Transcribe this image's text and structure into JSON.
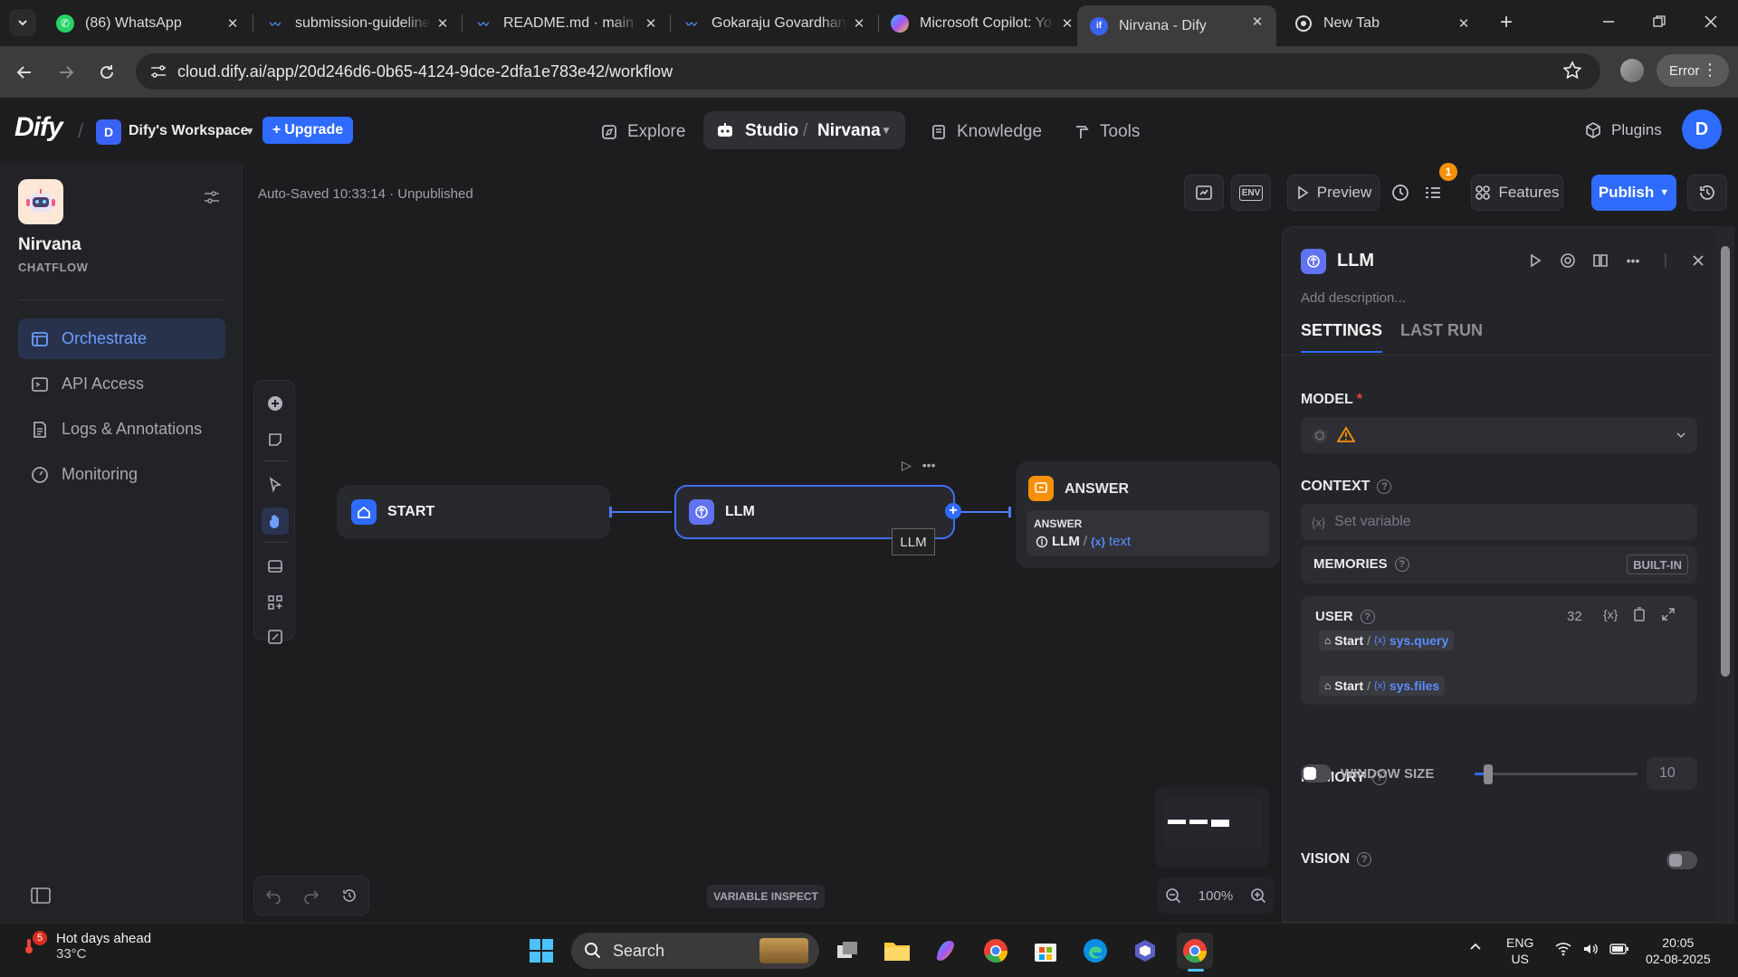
{
  "browser": {
    "tabs": [
      {
        "title": "(86) WhatsApp",
        "icon": "whatsapp-icon",
        "active": false
      },
      {
        "title": "submission-guidelines",
        "icon": "dify-icon",
        "active": false
      },
      {
        "title": "README.md · main ·",
        "icon": "dify-icon",
        "active": false
      },
      {
        "title": "Gokaraju Govardhan",
        "icon": "dify-icon",
        "active": false
      },
      {
        "title": "Microsoft Copilot: Yo",
        "icon": "copilot-icon",
        "active": false
      },
      {
        "title": "Nirvana - Dify",
        "icon": "dify-icon",
        "active": true
      },
      {
        "title": "New Tab",
        "icon": "chrome-icon",
        "active": false
      }
    ],
    "url": "cloud.dify.ai/app/20d246d6-0b65-4124-9dce-2dfa1e783e42/workflow",
    "error_label": "Error"
  },
  "header": {
    "logo": "Dify",
    "workspace_initial": "D",
    "workspace_name": "Dify's Workspace",
    "upgrade_label": "Upgrade",
    "nav": {
      "explore": "Explore",
      "studio": "Studio",
      "studio_app": "Nirvana",
      "knowledge": "Knowledge",
      "tools": "Tools"
    },
    "plugins_label": "Plugins",
    "user_initial": "D"
  },
  "sidebar": {
    "app_name": "Nirvana",
    "app_type": "CHATFLOW",
    "items": [
      {
        "label": "Orchestrate",
        "active": true
      },
      {
        "label": "API Access",
        "active": false
      },
      {
        "label": "Logs & Annotations",
        "active": false
      },
      {
        "label": "Monitoring",
        "active": false
      }
    ]
  },
  "canvas": {
    "autosave_text": "Auto-Saved 10:33:14 · Unpublished",
    "toolbar": {
      "env_label": "ENV",
      "preview_label": "Preview",
      "checklist_badge": "1",
      "features_label": "Features",
      "publish_label": "Publish"
    },
    "nodes": {
      "start": "START",
      "llm": "LLM",
      "answer": "ANSWER",
      "answer_field": "ANSWER",
      "answer_ref_node": "LLM",
      "answer_ref_sep": "/",
      "answer_ref_var": "text"
    },
    "tooltip": "LLM",
    "variable_inspect": "VARIABLE INSPECT",
    "zoom": "100%"
  },
  "panel": {
    "title": "LLM",
    "description_placeholder": "Add description...",
    "tabs": [
      "SETTINGS",
      "LAST RUN"
    ],
    "model_label": "MODEL",
    "required_mark": "*",
    "context_label": "CONTEXT",
    "context_placeholder": "Set variable",
    "memories_label": "MEMORIES",
    "builtin_label": "BUILT-IN",
    "user_label": "USER",
    "user_count": "32",
    "chips": [
      {
        "node": "Start",
        "sep": "/",
        "var": "sys.query"
      },
      {
        "node": "Start",
        "sep": "/",
        "var": "sys.files"
      }
    ],
    "memory_label": "MEMORY",
    "memory_enabled": true,
    "window_size_label": "WINDOW SIZE",
    "window_size_enabled": false,
    "window_size_value": "10",
    "vision_label": "VISION",
    "vision_enabled": false
  },
  "taskbar": {
    "weather_badge": "5",
    "weather_title": "Hot days ahead",
    "weather_temp": "33°C",
    "search_label": "Search",
    "lang1": "ENG",
    "lang2": "US",
    "time": "20:05",
    "date": "02-08-2025"
  }
}
